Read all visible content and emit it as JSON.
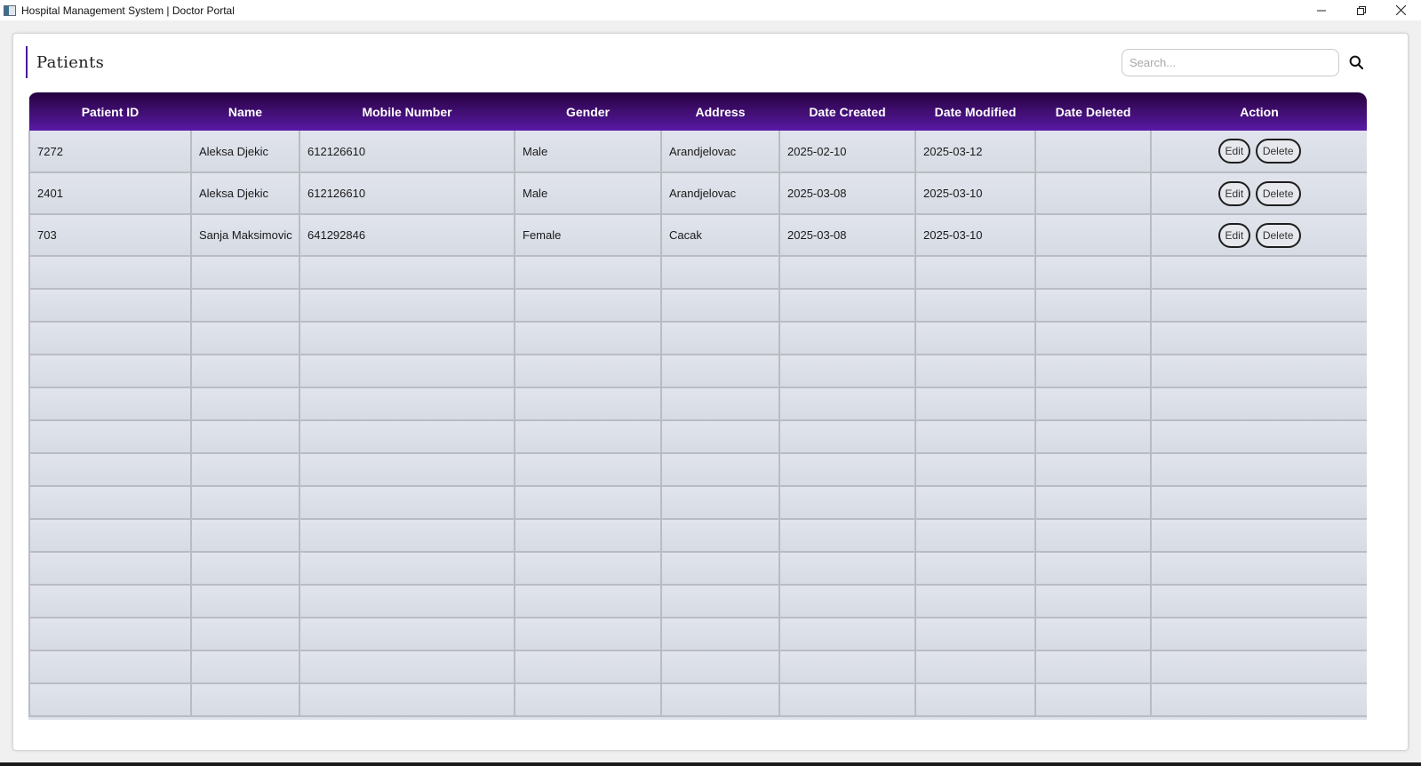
{
  "window": {
    "title": "Hospital Management System | Doctor Portal",
    "controls": [
      "minimize-icon",
      "restore-icon",
      "close-icon"
    ]
  },
  "page": {
    "title": "Patients"
  },
  "search": {
    "placeholder": "Search...",
    "value": "",
    "icon": "search-icon"
  },
  "table": {
    "columns": [
      "Patient ID",
      "Name",
      "Mobile Number",
      "Gender",
      "Address",
      "Date Created",
      "Date Modified",
      "Date Deleted",
      "Action"
    ],
    "rows": [
      {
        "patient_id": "7272",
        "name": "Aleksa Djekic",
        "mobile": "612126610",
        "gender": "Male",
        "address": "Arandjelovac",
        "date_created": "2025-02-10",
        "date_modified": "2025-03-12",
        "date_deleted": ""
      },
      {
        "patient_id": "2401",
        "name": "Aleksa Djekic",
        "mobile": "612126610",
        "gender": "Male",
        "address": "Arandjelovac",
        "date_created": "2025-03-08",
        "date_modified": "2025-03-10",
        "date_deleted": ""
      },
      {
        "patient_id": "703",
        "name": "Sanja Maksimovic",
        "mobile": "641292846",
        "gender": "Female",
        "address": "Cacak",
        "date_created": "2025-03-08",
        "date_modified": "2025-03-10",
        "date_deleted": ""
      }
    ],
    "actions": {
      "edit_label": "Edit",
      "delete_label": "Delete"
    }
  },
  "colors": {
    "header_gradient_dark": "#24003e",
    "header_gradient_light": "#5a1aa8",
    "accent": "#4a1a9a",
    "row_bg": "#dde1e9",
    "grid_line": "#b9bcc2"
  }
}
